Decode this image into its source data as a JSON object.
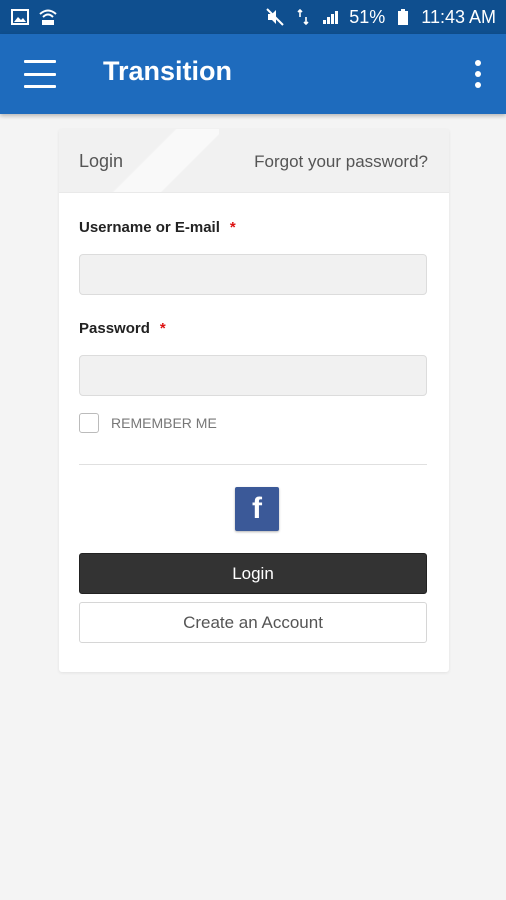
{
  "status_bar": {
    "battery": "51%",
    "time": "11:43 AM",
    "icons": [
      "image-icon",
      "wifi-calling-icon",
      "mute-icon",
      "data-4g-icon",
      "signal-icon",
      "battery-icon"
    ]
  },
  "app_bar": {
    "title": "Transition",
    "color": "#1e6bbd"
  },
  "login_card": {
    "title": "Login",
    "forgot_link": "Forgot your password?",
    "username": {
      "label": "Username or E-mail",
      "required_mark": "*",
      "value": "",
      "placeholder": ""
    },
    "password": {
      "label": "Password",
      "required_mark": "*",
      "value": "",
      "placeholder": ""
    },
    "remember_me": {
      "label": "REMEMBER ME",
      "checked": false
    },
    "facebook_button": {
      "glyph": "f",
      "color": "#3b5998"
    },
    "login_button": "Login",
    "create_account_button": "Create an Account"
  }
}
